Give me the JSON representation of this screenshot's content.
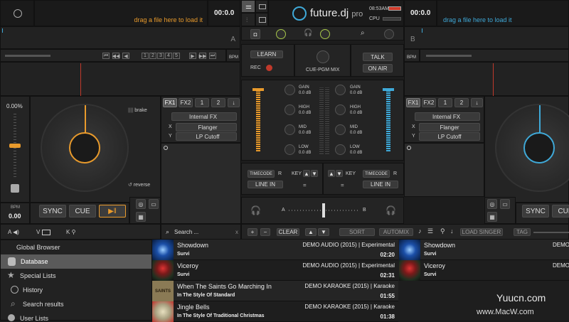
{
  "deck_a": {
    "time": "00:0.0",
    "drag_hint": "drag a file here to load it",
    "letter": "A",
    "cue_numbers": [
      "1",
      "2",
      "3",
      "4",
      "5"
    ],
    "bpm_tag": "BPM",
    "pitch_percent": "0.00%",
    "bpm_label": "BPM",
    "bpm_value": "0.00",
    "brake": "brake",
    "reverse": "reverse",
    "sync": "SYNC",
    "cue": "CUE",
    "play": "▶‖",
    "fx1": "FX1",
    "fx2": "FX2",
    "fx_num1": "1",
    "fx_num2": "2",
    "internal_fx": "Internal FX",
    "x_label": "X",
    "y_label": "Y",
    "x_fx": "Flanger",
    "y_fx": "LP Cutoff",
    "accent": "#e89a2c"
  },
  "deck_b": {
    "time": "00:0.0",
    "drag_hint": "drag a file here to load it",
    "letter": "B",
    "bpm_tag": "BPM",
    "sync": "SYNC",
    "cue": "CUE",
    "fx1": "FX1",
    "fx2": "FX2",
    "fx_num1": "1",
    "fx_num2": "2",
    "internal_fx": "Internal FX",
    "x_label": "X",
    "y_label": "Y",
    "x_fx": "Flanger",
    "y_fx": "LP Cutoff",
    "accent": "#3fa9d8"
  },
  "header": {
    "logo": "future.dj",
    "logo_suffix": "pro",
    "clock": "08:53AM",
    "battery": "Battery",
    "cpu": "CPU"
  },
  "mixer": {
    "learn": "LEARN",
    "rec": "REC",
    "cue_pgm_mix": "CUE-PGM MIX",
    "talk": "TALK",
    "on_air": "ON AIR",
    "eq_left": [
      {
        "label": "GAIN",
        "value": "0.0 dB"
      },
      {
        "label": "HIGH",
        "value": "0.0 dB"
      },
      {
        "label": "MID",
        "value": "0.0 dB"
      },
      {
        "label": "LOW",
        "value": "0.0 dB"
      }
    ],
    "eq_right": [
      {
        "label": "GAIN",
        "value": "0.0 dB"
      },
      {
        "label": "HIGH",
        "value": "0.0 dB"
      },
      {
        "label": "MID",
        "value": "0.0 dB"
      },
      {
        "label": "LOW",
        "value": "0.0 dB"
      }
    ],
    "timecode": "TIMECODE",
    "r": "R",
    "key": "KEY",
    "line_in": "LINE IN",
    "equals": "=",
    "cross_a": "A",
    "cross_b": "B"
  },
  "bottom_left": {
    "a_label": "A",
    "v_label": "V",
    "k_label": "K"
  },
  "browser_bar": {
    "search_placeholder": "Search ...",
    "clear_x": "x",
    "plus": "+",
    "minus": "−",
    "clear": "CLEAR",
    "sort": "SORT",
    "automix": "AUTOMIX",
    "load_singer": "LOAD SINGER",
    "tag": "TAG"
  },
  "sidebar": {
    "items": [
      {
        "label": "Global Browser"
      },
      {
        "label": "Database"
      },
      {
        "label": "Special Lists"
      },
      {
        "label": "History"
      },
      {
        "label": "Search results"
      },
      {
        "label": "User Lists"
      }
    ]
  },
  "tracks": [
    {
      "title": "Showdown",
      "artist": "Survi",
      "album": "DEMO AUDIO (2015) | Experimental",
      "duration": "02:20"
    },
    {
      "title": "Viceroy",
      "artist": "Survi",
      "album": "DEMO AUDIO (2015) | Experimental",
      "duration": "02:31"
    },
    {
      "title": "When The Saints Go Marching In",
      "artist": "In The Style Of Standard",
      "album": "DEMO KARAOKE (2015) | Karaoke",
      "duration": "01:55",
      "thumb_text": "SAINTS"
    },
    {
      "title": "Jingle Bells",
      "artist": "In The Style Of Traditional Christmas",
      "album": "DEMO KARAOKE (2015) | Karaoke",
      "duration": "01:38"
    }
  ],
  "tracks_right": [
    {
      "title": "Showdown",
      "artist": "Survi",
      "album": "DEMO"
    },
    {
      "title": "Viceroy",
      "artist": "Survi",
      "album": "DEMO"
    }
  ],
  "watermark": {
    "line1": "Yuucn.com",
    "line2": "www.MacW.com"
  }
}
